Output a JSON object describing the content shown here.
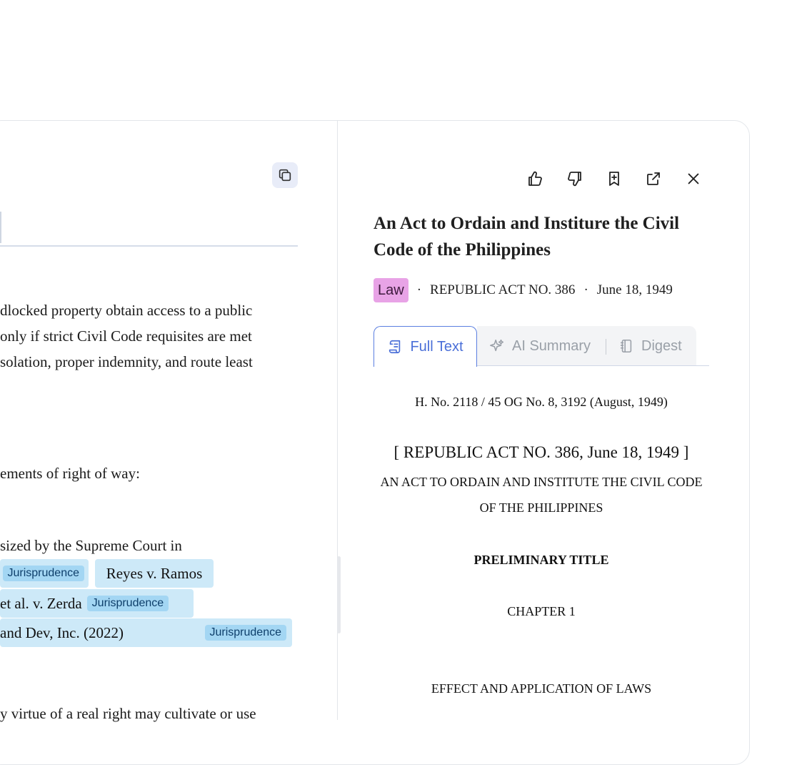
{
  "left": {
    "paragraph_lines": [
      "dlocked property obtain access to a public",
      "only if strict Civil Code requisites are met",
      "solation, proper indemnity, and route least"
    ],
    "requirements_line": "ements of right of way:",
    "emphasis_line": "sized by the Supreme Court in",
    "citations": [
      {
        "text": "",
        "tag": "Jurisprudence"
      },
      {
        "text": "Reyes v. Ramos",
        "tag": ""
      },
      {
        "text": "et al. v. Zerda",
        "tag": "Jurisprudence"
      },
      {
        "text": "and Dev, Inc. (2022)",
        "tag": "Jurisprudence"
      }
    ],
    "bottom_line": "y virtue of a real right may cultivate or use"
  },
  "toolbar": {
    "icons": [
      "thumbs-up-icon",
      "thumbs-down-icon",
      "bookmark-add-icon",
      "external-link-icon",
      "close-icon"
    ]
  },
  "document": {
    "title": "An Act to Ordain and Institure the Civil Code of the Philippines",
    "badge": "Law",
    "act_number": "REPUBLIC ACT NO. 386",
    "date": "June 18, 1949",
    "separator": "·"
  },
  "tabs": [
    {
      "label": "Full Text",
      "icon": "scroll-icon",
      "active": true
    },
    {
      "label": "AI Summary",
      "icon": "sparkle-icon",
      "active": false
    },
    {
      "label": "Digest",
      "icon": "notebook-icon",
      "active": false
    }
  ],
  "content": {
    "reference": "H. No. 2118 / 45 OG No. 8, 3192 (August, 1949)",
    "heading": "[ REPUBLIC ACT NO. 386, June 18, 1949 ]",
    "subheading": "AN ACT TO ORDAIN AND INSTITUTE THE CIVIL CODE OF THE PHILIPPINES",
    "title": "PRELIMINARY TITLE",
    "chapter": "CHAPTER 1",
    "section": "EFFECT AND APPLICATION OF LAWS"
  },
  "colors": {
    "accent": "#4a6fd8",
    "citation_bg": "#cde9f8",
    "tag_bg": "#a3d6f3",
    "law_badge": "#e8a3e6"
  }
}
